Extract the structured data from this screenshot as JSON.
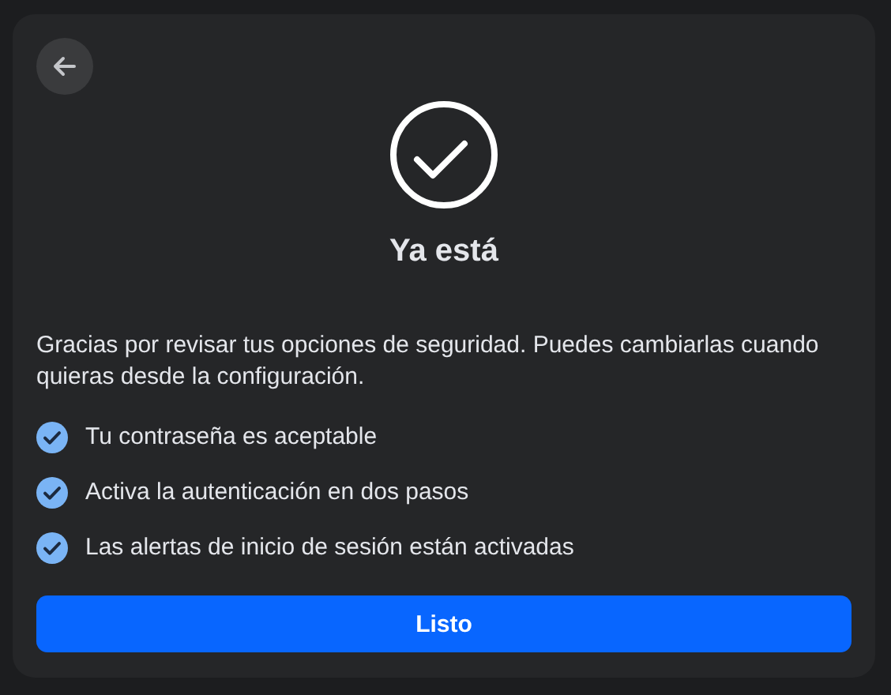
{
  "title": "Ya está",
  "description": "Gracias por revisar tus opciones de seguridad. Puedes cambiarlas cuando quieras desde la configuración.",
  "items": [
    {
      "label": "Tu contraseña es aceptable"
    },
    {
      "label": "Activa la autenticación en dos pasos"
    },
    {
      "label": "Las alertas de inicio de sesión están activadas"
    }
  ],
  "button": "Listo"
}
